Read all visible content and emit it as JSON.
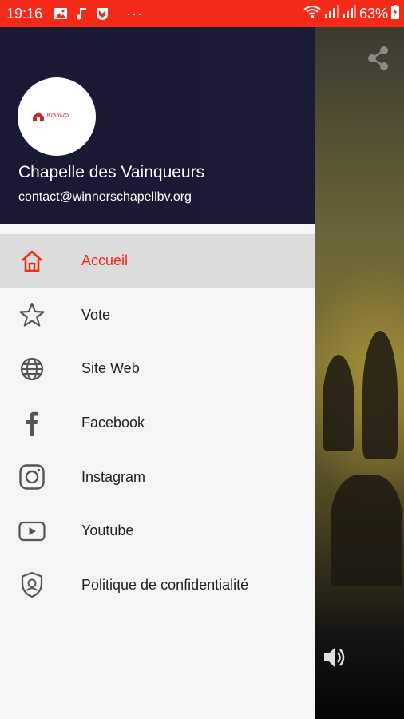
{
  "status_bar": {
    "time": "19:16",
    "more": "···",
    "battery": "63%",
    "icons": [
      "image-icon",
      "music-note-icon",
      "shield-app-icon",
      "wifi-icon",
      "signal-icon",
      "signal-icon",
      "battery-icon"
    ]
  },
  "colors": {
    "accent": "#f52a18",
    "header_bg": "#181a33",
    "drawer_bg": "#f5f5f5",
    "active_bg": "#dcdcdc",
    "text": "#212121",
    "icon": "#555555"
  },
  "drawer": {
    "header": {
      "logo_text": "WINNERS",
      "title": "Chapelle des Vainqueurs",
      "email": "contact@winnerschapellbv.org"
    },
    "items": [
      {
        "label": "Accueil",
        "icon": "home-icon",
        "active": true
      },
      {
        "label": "Vote",
        "icon": "star-icon",
        "active": false
      },
      {
        "label": "Site Web",
        "icon": "globe-icon",
        "active": false
      },
      {
        "label": "Facebook",
        "icon": "facebook-icon",
        "active": false
      },
      {
        "label": "Instagram",
        "icon": "instagram-icon",
        "active": false
      },
      {
        "label": "Youtube",
        "icon": "youtube-icon",
        "active": false
      },
      {
        "label": "Politique de confidentialité",
        "icon": "privacy-shield-icon",
        "active": false
      }
    ]
  },
  "background": {
    "share_icon": "share-icon",
    "volume_icon": "volume-icon"
  }
}
